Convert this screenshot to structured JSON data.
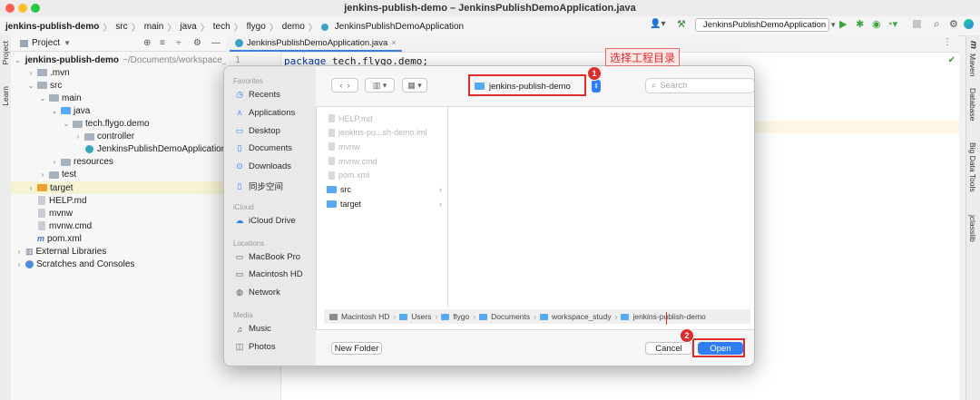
{
  "window": {
    "title": "jenkins-publish-demo – JenkinsPublishDemoApplication.java"
  },
  "breadcrumbs": [
    "jenkins-publish-demo",
    "src",
    "main",
    "java",
    "tech",
    "flygo",
    "demo",
    "JenkinsPublishDemoApplication"
  ],
  "run_config": "JenkinsPublishDemoApplication",
  "left_strip": {
    "project": "Project",
    "learn": "Learn"
  },
  "right_strip": {
    "maven": "Maven",
    "database": "Database",
    "bigdata": "Big Data Tools",
    "jclasslib": "jclasslib"
  },
  "project_panel": {
    "title": "Project",
    "tree": [
      {
        "label": "jenkins-publish-demo",
        "suffix": "~/Documents/workspace_study",
        "depth": 0,
        "chev": "v",
        "kind": "folder-blue",
        "bold": true
      },
      {
        "label": ".mvn",
        "depth": 1,
        "chev": ">",
        "kind": "folder-gray"
      },
      {
        "label": "src",
        "depth": 1,
        "chev": "v",
        "kind": "folder-gray"
      },
      {
        "label": "main",
        "depth": 2,
        "chev": "v",
        "kind": "folder-gray"
      },
      {
        "label": "java",
        "depth": 3,
        "chev": "v",
        "kind": "folder-blue"
      },
      {
        "label": "tech.flygo.demo",
        "depth": 4,
        "chev": "v",
        "kind": "folder-gray"
      },
      {
        "label": "controller",
        "depth": 5,
        "chev": ">",
        "kind": "folder-gray"
      },
      {
        "label": "JenkinsPublishDemoApplication",
        "depth": 5,
        "chev": "",
        "kind": "class"
      },
      {
        "label": "resources",
        "depth": 3,
        "chev": ">",
        "kind": "folder-gray"
      },
      {
        "label": "test",
        "depth": 2,
        "chev": ">",
        "kind": "folder-gray"
      },
      {
        "label": "target",
        "depth": 1,
        "chev": ">",
        "kind": "folder-orange",
        "selected": true
      },
      {
        "label": "HELP.md",
        "depth": 1,
        "chev": "",
        "kind": "file"
      },
      {
        "label": "mvnw",
        "depth": 1,
        "chev": "",
        "kind": "file"
      },
      {
        "label": "mvnw.cmd",
        "depth": 1,
        "chev": "",
        "kind": "file"
      },
      {
        "label": "pom.xml",
        "depth": 1,
        "chev": "",
        "kind": "maven"
      },
      {
        "label": "External Libraries",
        "depth": 0,
        "chev": ">",
        "kind": "lib"
      },
      {
        "label": "Scratches and Consoles",
        "depth": 0,
        "chev": ">",
        "kind": "scratch"
      }
    ]
  },
  "editor": {
    "tab": "JenkinsPublishDemoApplication.java",
    "line_number": "1",
    "code_keyword": "package",
    "code_rest": " tech.flygo.demo;"
  },
  "dialog": {
    "sidebar": [
      {
        "head": "Favorites"
      },
      {
        "item": "Recents",
        "icon": "clock-icon"
      },
      {
        "item": "Applications",
        "icon": "applications-icon"
      },
      {
        "item": "Desktop",
        "icon": "desktop-icon"
      },
      {
        "item": "Documents",
        "icon": "document-icon"
      },
      {
        "item": "Downloads",
        "icon": "download-icon"
      },
      {
        "item": "同步空间",
        "icon": "document-icon"
      },
      {
        "head": "iCloud"
      },
      {
        "item": "iCloud Drive",
        "icon": "cloud-icon"
      },
      {
        "head": "Locations"
      },
      {
        "item": "MacBook Pro",
        "icon": "laptop-icon"
      },
      {
        "item": "Macintosh HD",
        "icon": "drive-icon"
      },
      {
        "item": "Network",
        "icon": "globe-icon"
      },
      {
        "head": "Media"
      },
      {
        "item": "Music",
        "icon": "music-icon"
      },
      {
        "item": "Photos",
        "icon": "camera-icon"
      }
    ],
    "location": "jenkins-publish-demo",
    "search_placeholder": "Search",
    "files": [
      {
        "name": "HELP.md",
        "enabled": false,
        "kind": "file"
      },
      {
        "name": "jenkins-pu...sh-demo.iml",
        "enabled": false,
        "kind": "file"
      },
      {
        "name": "mvnw",
        "enabled": false,
        "kind": "file"
      },
      {
        "name": "mvnw.cmd",
        "enabled": false,
        "kind": "file"
      },
      {
        "name": "pom.xml",
        "enabled": false,
        "kind": "file"
      },
      {
        "name": "src",
        "enabled": true,
        "kind": "folder"
      },
      {
        "name": "target",
        "enabled": true,
        "kind": "folder"
      }
    ],
    "path": [
      "Macintosh HD",
      "Users",
      "flygo",
      "Documents",
      "workspace_study",
      "jenkins-publish-demo"
    ],
    "new_folder": "New Folder",
    "cancel": "Cancel",
    "open": "Open"
  },
  "annotations": {
    "label": "选择工程目录",
    "badge1": "1",
    "badge2": "2"
  },
  "colors": {
    "accent": "#2d7ef7",
    "annotation": "#e02b2b",
    "selection": "#f6f3d4"
  }
}
